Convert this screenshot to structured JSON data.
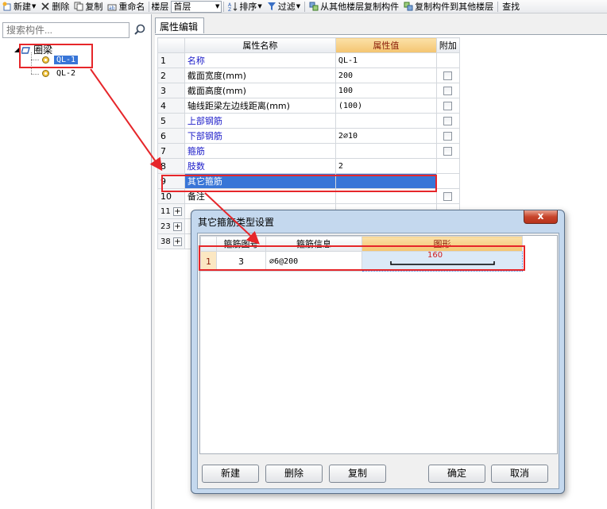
{
  "toolbar": {
    "new": "新建",
    "delete": "删除",
    "copy": "复制",
    "rename": "重命名",
    "floor_label": "楼层",
    "floor_value": "首层",
    "sort": "排序",
    "filter": "过滤",
    "copy_from_other": "从其他楼层复制构件",
    "copy_to_other": "复制构件到其他楼层",
    "find": "查找"
  },
  "left_panel": {
    "search_placeholder": "搜索构件...",
    "tree_root": "圈梁",
    "tree_items": [
      "QL-1",
      "QL-2"
    ]
  },
  "main": {
    "tab": "属性编辑",
    "headers": {
      "name": "属性名称",
      "value": "属性值",
      "extra": "附加"
    },
    "rows": [
      {
        "no": "1",
        "name": "名称",
        "value": "QL-1"
      },
      {
        "no": "2",
        "name": "截面宽度(mm)",
        "value": "200"
      },
      {
        "no": "3",
        "name": "截面高度(mm)",
        "value": "100"
      },
      {
        "no": "4",
        "name": "轴线距梁左边线距离(mm)",
        "value": "(100)"
      },
      {
        "no": "5",
        "name": "上部钢筋",
        "value": ""
      },
      {
        "no": "6",
        "name": "下部钢筋",
        "value": "2⌀10"
      },
      {
        "no": "7",
        "name": "箍筋",
        "value": ""
      },
      {
        "no": "8",
        "name": "肢数",
        "value": "2"
      },
      {
        "no": "9",
        "name": "其它箍筋",
        "value": ""
      },
      {
        "no": "10",
        "name": "备注",
        "value": ""
      },
      {
        "no": "11",
        "name": "",
        "value": ""
      },
      {
        "no": "23",
        "name": "",
        "value": ""
      },
      {
        "no": "38",
        "name": "",
        "value": ""
      }
    ]
  },
  "dialog": {
    "title": "其它箍筋类型设置",
    "close": "x",
    "headers": {
      "shape_no": "箍筋图号",
      "info": "箍筋信息",
      "shape": "图形"
    },
    "row": {
      "no": "1",
      "shape_no": "3",
      "info": "⌀6@200",
      "shape_value": "160"
    },
    "buttons": {
      "new": "新建",
      "delete": "删除",
      "copy": "复制",
      "ok": "确定",
      "cancel": "取消"
    }
  },
  "colors": {
    "annotation": "#e6262a",
    "selection": "#3875d7",
    "header_highlight": "#f4c470"
  }
}
